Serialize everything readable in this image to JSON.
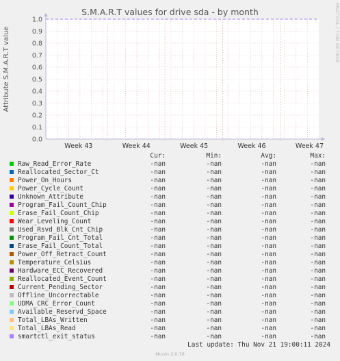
{
  "chart_data": {
    "type": "line",
    "title": "S.M.A.R.T values for drive sda - by month",
    "ylabel": "Attribute S.M.A.R.T value",
    "xlabel": "",
    "ylim": [
      0.0,
      1.0
    ],
    "yticks": [
      "0.0",
      "0.1",
      "0.2",
      "0.3",
      "0.4",
      "0.5",
      "0.6",
      "0.7",
      "0.8",
      "0.9",
      "1.0"
    ],
    "xticks": [
      "Week 43",
      "Week 44",
      "Week 45",
      "Week 46",
      "Week 47"
    ],
    "grid": true,
    "series": [
      {
        "name": "Raw_Read_Error_Rate",
        "color": "#00cc00",
        "cur": "-nan",
        "min": "-nan",
        "avg": "-nan",
        "max": "-nan"
      },
      {
        "name": "Reallocated_Sector_Ct",
        "color": "#0066b3",
        "cur": "-nan",
        "min": "-nan",
        "avg": "-nan",
        "max": "-nan"
      },
      {
        "name": "Power_On_Hours",
        "color": "#ff8000",
        "cur": "-nan",
        "min": "-nan",
        "avg": "-nan",
        "max": "-nan"
      },
      {
        "name": "Power_Cycle_Count",
        "color": "#ffcc00",
        "cur": "-nan",
        "min": "-nan",
        "avg": "-nan",
        "max": "-nan"
      },
      {
        "name": "Unknown_Attribute",
        "color": "#330099",
        "cur": "-nan",
        "min": "-nan",
        "avg": "-nan",
        "max": "-nan"
      },
      {
        "name": "Program_Fail_Count_Chip",
        "color": "#990099",
        "cur": "-nan",
        "min": "-nan",
        "avg": "-nan",
        "max": "-nan"
      },
      {
        "name": "Erase_Fail_Count_Chip",
        "color": "#ccff00",
        "cur": "-nan",
        "min": "-nan",
        "avg": "-nan",
        "max": "-nan"
      },
      {
        "name": "Wear_Leveling_Count",
        "color": "#ff0000",
        "cur": "-nan",
        "min": "-nan",
        "avg": "-nan",
        "max": "-nan"
      },
      {
        "name": "Used_Rsvd_Blk_Cnt_Chip",
        "color": "#808080",
        "cur": "-nan",
        "min": "-nan",
        "avg": "-nan",
        "max": "-nan"
      },
      {
        "name": "Program_Fail_Cnt_Total",
        "color": "#008f00",
        "cur": "-nan",
        "min": "-nan",
        "avg": "-nan",
        "max": "-nan"
      },
      {
        "name": "Erase_Fail_Count_Total",
        "color": "#00487d",
        "cur": "-nan",
        "min": "-nan",
        "avg": "-nan",
        "max": "-nan"
      },
      {
        "name": "Power_Off_Retract_Count",
        "color": "#b35a00",
        "cur": "-nan",
        "min": "-nan",
        "avg": "-nan",
        "max": "-nan"
      },
      {
        "name": "Temperature_Celsius",
        "color": "#b38f00",
        "cur": "-nan",
        "min": "-nan",
        "avg": "-nan",
        "max": "-nan"
      },
      {
        "name": "Hardware_ECC_Recovered",
        "color": "#6b006b",
        "cur": "-nan",
        "min": "-nan",
        "avg": "-nan",
        "max": "-nan"
      },
      {
        "name": "Reallocated_Event_Count",
        "color": "#8fb300",
        "cur": "-nan",
        "min": "-nan",
        "avg": "-nan",
        "max": "-nan"
      },
      {
        "name": "Current_Pending_Sector",
        "color": "#b30000",
        "cur": "-nan",
        "min": "-nan",
        "avg": "-nan",
        "max": "-nan"
      },
      {
        "name": "Offline_Uncorrectable",
        "color": "#bebebe",
        "cur": "-nan",
        "min": "-nan",
        "avg": "-nan",
        "max": "-nan"
      },
      {
        "name": "UDMA_CRC_Error_Count",
        "color": "#80ff80",
        "cur": "-nan",
        "min": "-nan",
        "avg": "-nan",
        "max": "-nan"
      },
      {
        "name": "Available_Reservd_Space",
        "color": "#80c9ff",
        "cur": "-nan",
        "min": "-nan",
        "avg": "-nan",
        "max": "-nan"
      },
      {
        "name": "Total_LBAs_Written",
        "color": "#ffc080",
        "cur": "-nan",
        "min": "-nan",
        "avg": "-nan",
        "max": "-nan"
      },
      {
        "name": "Total_LBAs_Read",
        "color": "#ffe680",
        "cur": "-nan",
        "min": "-nan",
        "avg": "-nan",
        "max": "-nan"
      },
      {
        "name": "smartctl_exit_status",
        "color": "#aa80ff",
        "cur": "-nan",
        "min": "-nan",
        "avg": "-nan",
        "max": "-nan"
      }
    ],
    "threshold_line": {
      "value": 1.0,
      "color": "#a080ff"
    }
  },
  "legend_headers": {
    "cur": "Cur:",
    "min": "Min:",
    "avg": "Avg:",
    "max": "Max:"
  },
  "last_update": "Last update: Thu Nov 21 19:00:11 2024",
  "side_label": "RRDTOOL / TOBI OETIKER",
  "footer": "Munin 2.0.76"
}
